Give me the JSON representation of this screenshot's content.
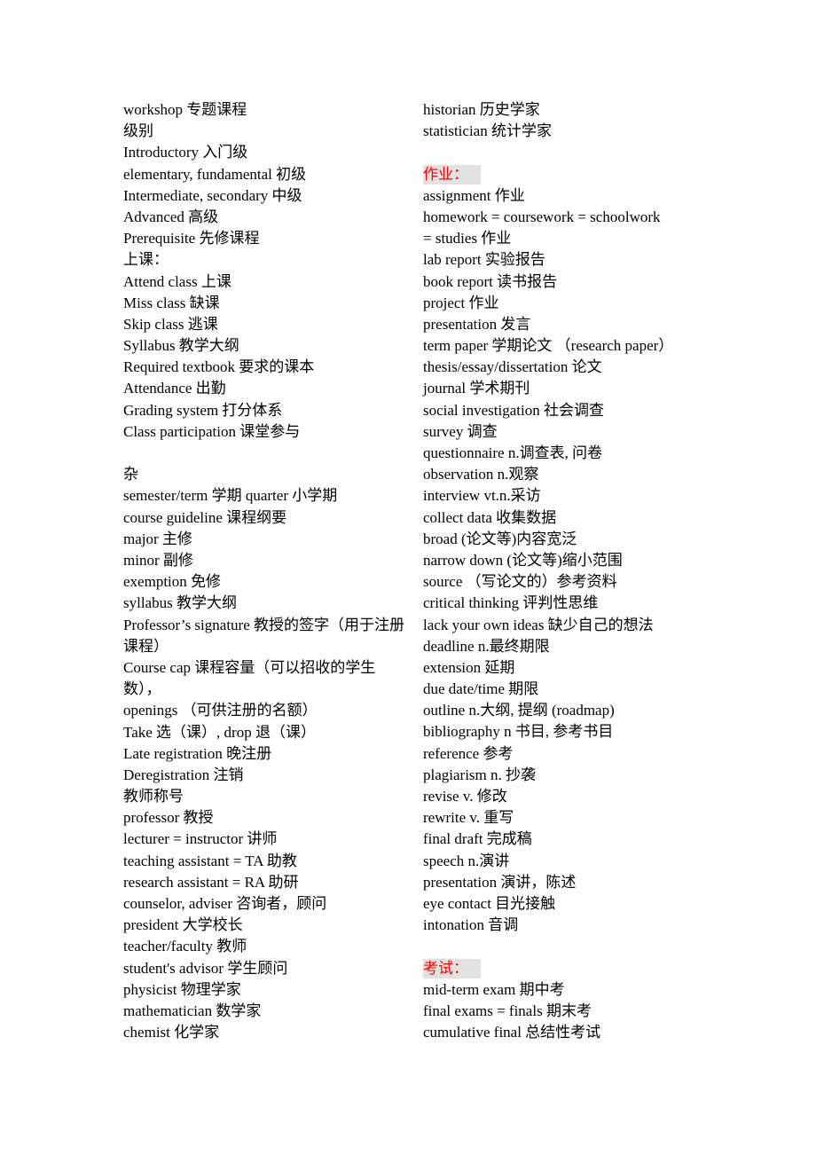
{
  "left_column": [
    {
      "text": "workshop  专题课程"
    },
    {
      "text": "级别"
    },
    {
      "text": "Introductory  入门级"
    },
    {
      "text": "elementary, fundamental  初级"
    },
    {
      "text": "Intermediate, secondary  中级"
    },
    {
      "text": "Advanced  高级"
    },
    {
      "text": "Prerequisite  先修课程"
    },
    {
      "text": "上课："
    },
    {
      "text": "Attend class  上课"
    },
    {
      "text": "Miss class  缺课"
    },
    {
      "text": "Skip class 逃课"
    },
    {
      "text": "Syllabus  教学大纲"
    },
    {
      "text": "Required textbook  要求的课本"
    },
    {
      "text": "Attendance  出勤"
    },
    {
      "text": "Grading system  打分体系"
    },
    {
      "text": "Class participation  课堂参与"
    },
    {
      "text": ""
    },
    {
      "text": "杂"
    },
    {
      "text": "semester/term  学期  quarter 小学期"
    },
    {
      "text": "course guideline  课程纲要"
    },
    {
      "text": "major  主修"
    },
    {
      "text": "minor  副修"
    },
    {
      "text": "exemption  免修"
    },
    {
      "text": "syllabus  教学大纲"
    },
    {
      "text": "Professor’s signature  教授的签字（用于注册课程）",
      "wrap": true
    },
    {
      "text": "Course cap 课程容量（可以招收的学生数），",
      "wrap": true
    },
    {
      "text": "openings  （可供注册的名额）"
    },
    {
      "text": "Take 选（课）, drop  退（课）"
    },
    {
      "text": "Late registration 晚注册"
    },
    {
      "text": "Deregistration  注销"
    },
    {
      "text": "教师称号"
    },
    {
      "text": "professor  教授"
    },
    {
      "text": "lecturer = instructor  讲师"
    },
    {
      "text": "teaching assistant = TA  助教"
    },
    {
      "text": "research assistant = RA  助研"
    },
    {
      "text": "counselor, adviser  咨询者，顾问"
    },
    {
      "text": "president  大学校长"
    },
    {
      "text": "teacher/faculty  教师"
    },
    {
      "text": "student's advisor  学生顾问"
    },
    {
      "text": "physicist  物理学家"
    },
    {
      "text": "mathematician  数学家"
    },
    {
      "text": "chemist  化学家"
    }
  ],
  "right_column": [
    {
      "text": "historian  历史学家"
    },
    {
      "text": "statistician  统计学家"
    },
    {
      "text": ""
    },
    {
      "text": "作业：",
      "heading": true
    },
    {
      "text": "assignment  作业"
    },
    {
      "text": "homework  =  coursework  =  schoolwork"
    },
    {
      "text": "= studies  作业"
    },
    {
      "text": "lab report  实验报告"
    },
    {
      "text": "book report  读书报告"
    },
    {
      "text": "project  作业"
    },
    {
      "text": "presentation  发言"
    },
    {
      "text": "term paper  学期论文  （research paper）"
    },
    {
      "text": "thesis/essay/dissertation  论文"
    },
    {
      "text": "journal  学术期刊"
    },
    {
      "text": "social investigation  社会调查"
    },
    {
      "text": "survey  调查"
    },
    {
      "text": "questionnaire n.调查表, 问卷"
    },
    {
      "text": "observation n.观察"
    },
    {
      "text": "interview vt.n.采访"
    },
    {
      "text": "collect data  收集数据"
    },
    {
      "text": "broad (论文等)内容宽泛"
    },
    {
      "text": "narrow down (论文等)缩小范围"
    },
    {
      "text": "source  （写论文的）参考资料"
    },
    {
      "text": "critical thinking  评判性思维"
    },
    {
      "text": "lack your own ideas 缺少自己的想法"
    },
    {
      "text": "deadline n.最终期限"
    },
    {
      "text": "extension  延期"
    },
    {
      "text": "due date/time 期限"
    },
    {
      "text": "outline n.大纲, 提纲  (roadmap)"
    },
    {
      "text": "bibliography n 书目, 参考书目"
    },
    {
      "text": "reference  参考"
    },
    {
      "text": "plagiarism n.  抄袭"
    },
    {
      "text": "revise v.  修改"
    },
    {
      "text": "rewrite v.  重写"
    },
    {
      "text": "final draft  完成稿"
    },
    {
      "text": "speech n.演讲"
    },
    {
      "text": "presentation  演讲，陈述"
    },
    {
      "text": "eye contact  目光接触"
    },
    {
      "text": "intonation  音调"
    },
    {
      "text": ""
    },
    {
      "text": "考试：",
      "heading": true
    },
    {
      "text": "mid-term exam  期中考"
    },
    {
      "text": "final exams = finals  期末考"
    },
    {
      "text": "cumulative final  总结性考试"
    }
  ],
  "colors": {
    "heading_text": "#ff0000",
    "heading_highlight": "#e2e2e2",
    "body_text": "#000000"
  }
}
